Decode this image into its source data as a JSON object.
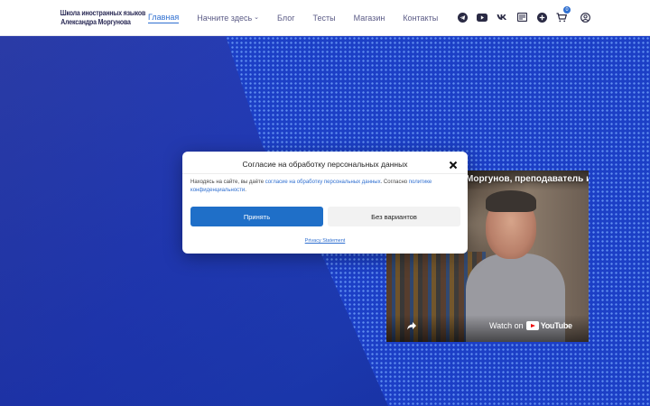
{
  "header": {
    "logo_line1": "Школа иностранных языков",
    "logo_line2": "Александра Моргунова",
    "nav": [
      {
        "label": "Главная",
        "active": true
      },
      {
        "label": "Начните здесь",
        "dropdown": true
      },
      {
        "label": "Блог"
      },
      {
        "label": "Тесты"
      },
      {
        "label": "Магазин"
      },
      {
        "label": "Контакты"
      }
    ],
    "icons": [
      "telegram-icon",
      "youtube-icon",
      "vk-icon",
      "rss-icon",
      "plus-icon",
      "cart-icon",
      "user-icon"
    ],
    "cart_count": "0",
    "accent_color": "#2f6fd0"
  },
  "video": {
    "title": "Моргунов, преподаватель и",
    "watch_on": "Watch on",
    "youtube": "YouTube"
  },
  "consent": {
    "title": "Согласие на обработку персональных данных",
    "text_part1": "Находясь на сайте, вы даёте ",
    "link1": "согласие на обработку персональных данных",
    "text_part2": ". Согласно ",
    "link2": "политике конфиденциальности",
    "text_part3": ".",
    "accept_label": "Принять",
    "deny_label": "Без вариантов",
    "privacy_link": "Privacy Statement"
  }
}
